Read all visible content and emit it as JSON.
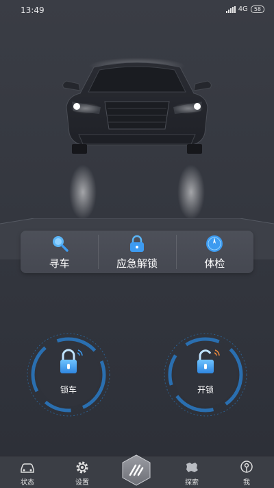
{
  "status_bar": {
    "time": "13:49",
    "network": "4G",
    "battery": "58"
  },
  "quick_actions": [
    {
      "label": "寻车",
      "icon": "search-car-icon"
    },
    {
      "label": "应急解锁",
      "icon": "emergency-unlock-icon"
    },
    {
      "label": "体检",
      "icon": "checkup-icon"
    }
  ],
  "lock_controls": {
    "lock_label": "锁车",
    "unlock_label": "开锁"
  },
  "bottom_nav": [
    {
      "label": "状态",
      "icon": "car-icon"
    },
    {
      "label": "设置",
      "icon": "gear-icon"
    },
    {
      "label": "",
      "icon": "home-logo-icon"
    },
    {
      "label": "探索",
      "icon": "map-icon"
    },
    {
      "label": "我",
      "icon": "profile-icon"
    }
  ],
  "colors": {
    "background": "#34373f",
    "accent_blue": "#3d9bf0",
    "accent_orange": "#f08a3c",
    "panel": "#4a4d56"
  }
}
